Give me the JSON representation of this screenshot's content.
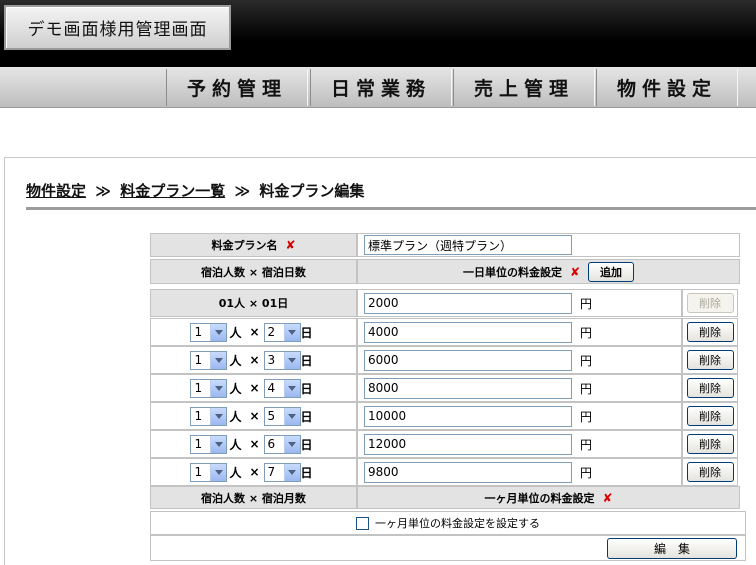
{
  "header": {
    "app_title": "デモ画面様用管理画面"
  },
  "menu": [
    {
      "label": "予約管理"
    },
    {
      "label": "日常業務"
    },
    {
      "label": "売上管理"
    },
    {
      "label": "物件設定"
    }
  ],
  "breadcrumb": {
    "items": [
      "物件設定",
      "料金プラン一覧"
    ],
    "separator": "≫",
    "current": "料金プラン編集"
  },
  "form": {
    "plan_name_label": "料金プラン名",
    "required_mark": "✘",
    "plan_name_value": "標準プラン（週特プラン）",
    "daily_header": {
      "left": "宿泊人数 × 宿泊日数",
      "right": "一日単位の料金設定",
      "add_button": "追加"
    },
    "first_row": {
      "label": "01人 × 01日",
      "price": "2000",
      "unit": "円",
      "delete": "削除"
    },
    "rows": [
      {
        "people": "1",
        "days": "2",
        "price": "4000"
      },
      {
        "people": "1",
        "days": "3",
        "price": "6000"
      },
      {
        "people": "1",
        "days": "4",
        "price": "8000"
      },
      {
        "people": "1",
        "days": "5",
        "price": "10000"
      },
      {
        "people": "1",
        "days": "6",
        "price": "12000"
      },
      {
        "people": "1",
        "days": "7",
        "price": "9800"
      }
    ],
    "row_labels": {
      "people_suffix": "人",
      "times": "×",
      "days_suffix": "日",
      "unit": "円",
      "delete": "削除"
    },
    "monthly_header": {
      "left": "宿泊人数 × 宿泊月数",
      "right": "一ヶ月単位の料金設定"
    },
    "monthly_checkbox_label": "一ヶ月単位の料金設定を設定する",
    "submit_button": "編　集"
  }
}
